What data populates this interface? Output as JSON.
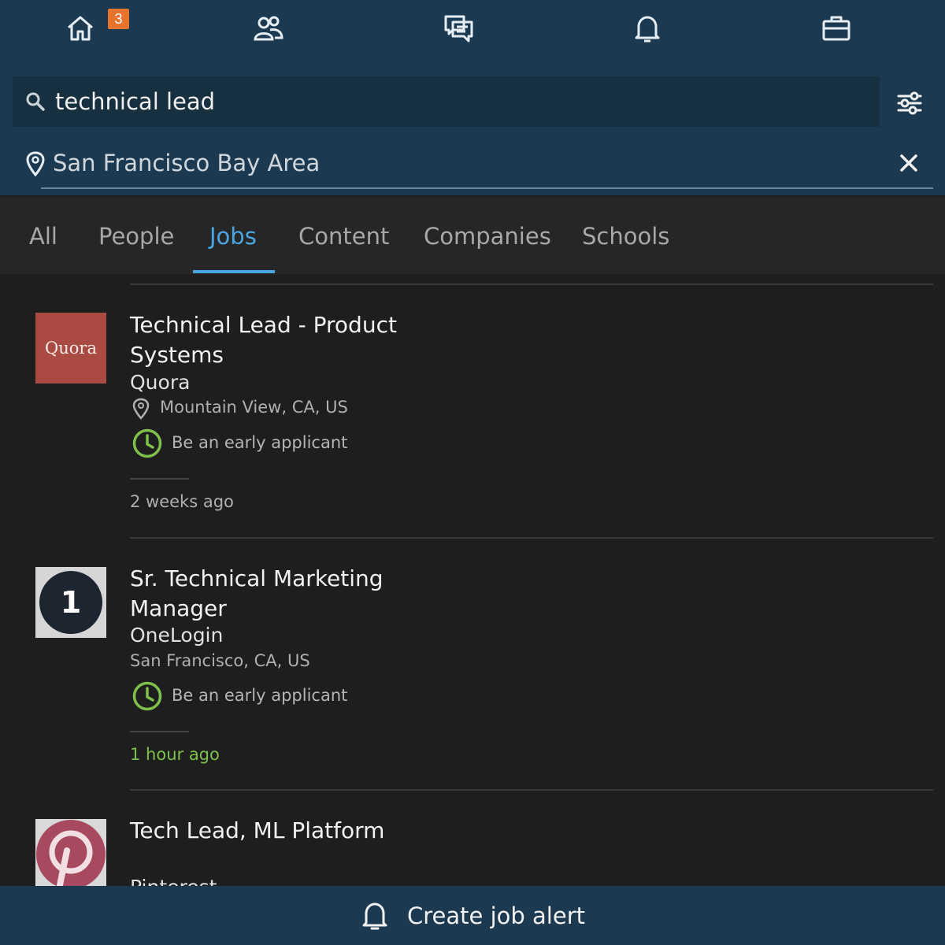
{
  "nav": {
    "icons": [
      "home-icon",
      "people-icon",
      "messages-icon",
      "bell-icon",
      "briefcase-icon"
    ],
    "home_badge": "3"
  },
  "search": {
    "query": "technical lead",
    "location": "San Francisco Bay Area"
  },
  "tabs": [
    {
      "label": "All"
    },
    {
      "label": "People"
    },
    {
      "label": "Jobs",
      "active": true
    },
    {
      "label": "Content"
    },
    {
      "label": "Companies"
    },
    {
      "label": "Schools"
    }
  ],
  "jobs": [
    {
      "title": "Technical Lead - Product Systems",
      "company": "Quora",
      "logo_text": "Quora",
      "location": "Mountain View, CA, US",
      "early": "Be an early applicant",
      "posted": "2 weeks ago"
    },
    {
      "title": "Sr. Technical Marketing Manager",
      "company": "OneLogin",
      "logo_text": "1",
      "location": "San Francisco, CA, US",
      "early": "Be an early applicant",
      "posted": "1 hour ago"
    },
    {
      "title": "Tech Lead, ML Platform",
      "company": "Pinterest"
    }
  ],
  "bottom": {
    "label": "Create job alert"
  },
  "colors": {
    "nav_bg": "#1b3a52",
    "accent": "#4aa6e3",
    "badge": "#e8732c",
    "green": "#7ec04a",
    "quora": "#a94a43",
    "pinterest": "#a84a5f"
  }
}
